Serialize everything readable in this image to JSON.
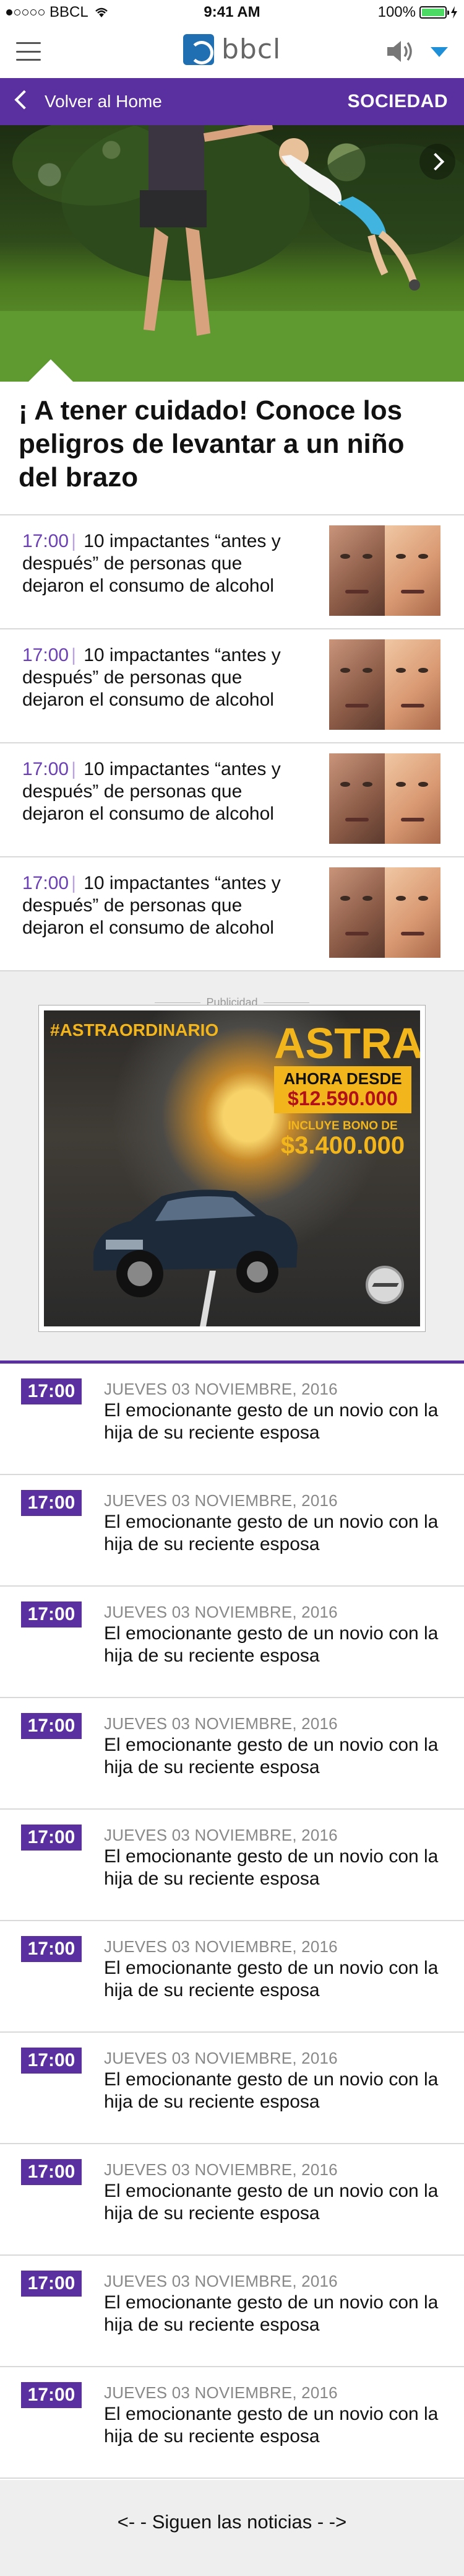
{
  "status_bar": {
    "carrier": "BBCL",
    "time": "9:41 AM",
    "battery": "100%"
  },
  "header": {
    "brand": "bbcl",
    "icons": [
      "menu-icon",
      "logo-icon",
      "speaker-icon",
      "caret-down-icon"
    ]
  },
  "section_bar": {
    "back_label": "Volver al Home",
    "section": "SOCIEDAD"
  },
  "article": {
    "headline": "¡ A tener cuidado! Conoce los peligros de levantar a un niño del brazo"
  },
  "related": [
    {
      "time": "17:00",
      "title": "10 impactantes “antes y después” de personas que dejaron el consumo de alcohol"
    },
    {
      "time": "17:00",
      "title": "10 impactantes “antes y después” de personas que dejaron el consumo de alcohol"
    },
    {
      "time": "17:00",
      "title": "10 impactantes “antes y después” de personas que dejaron el consumo de alcohol"
    },
    {
      "time": "17:00",
      "title": "10 impactantes “antes y después” de personas que dejaron el consumo de alcohol"
    }
  ],
  "ad": {
    "label": "Publicidad",
    "hashtag": "#ASTRAORDINARIO",
    "brand": "ASTRA",
    "line1": "AHORA DESDE",
    "price": "$12.590.000",
    "bonus_label": "INCLUYE BONO DE",
    "bonus": "$3.400.000"
  },
  "news": [
    {
      "time": "17:00",
      "date": "JUEVES 03 NOVIEMBRE, 2016",
      "title": "El emocionante gesto de un novio con la hija de su reciente esposa"
    },
    {
      "time": "17:00",
      "date": "JUEVES 03 NOVIEMBRE, 2016",
      "title": "El emocionante gesto de un novio con la hija de su reciente esposa"
    },
    {
      "time": "17:00",
      "date": "JUEVES 03 NOVIEMBRE, 2016",
      "title": "El emocionante gesto de un novio con la hija de su reciente esposa"
    },
    {
      "time": "17:00",
      "date": "JUEVES 03 NOVIEMBRE, 2016",
      "title": "El emocionante gesto de un novio con la hija de su reciente esposa"
    },
    {
      "time": "17:00",
      "date": "JUEVES 03 NOVIEMBRE, 2016",
      "title": "El emocionante gesto de un novio con la hija de su reciente esposa"
    },
    {
      "time": "17:00",
      "date": "JUEVES 03 NOVIEMBRE, 2016",
      "title": "El emocionante gesto de un novio con la hija de su reciente esposa"
    },
    {
      "time": "17:00",
      "date": "JUEVES 03 NOVIEMBRE, 2016",
      "title": "El emocionante gesto de un novio con la hija de su reciente esposa"
    },
    {
      "time": "17:00",
      "date": "JUEVES 03 NOVIEMBRE, 2016",
      "title": "El emocionante gesto de un novio con la hija de su reciente esposa"
    },
    {
      "time": "17:00",
      "date": "JUEVES 03 NOVIEMBRE, 2016",
      "title": "El emocionante gesto de un novio con la hija de su reciente esposa"
    },
    {
      "time": "17:00",
      "date": "JUEVES 03 NOVIEMBRE, 2016",
      "title": "El emocionante gesto de un novio con la hija de su reciente esposa"
    }
  ],
  "more_link": "<- - Siguen las noticias - ->",
  "colors": {
    "accent": "#5a2fa0",
    "logo": "#1f6fb2",
    "caret": "#1f8fd8",
    "ad_yellow": "#f2b61c"
  }
}
